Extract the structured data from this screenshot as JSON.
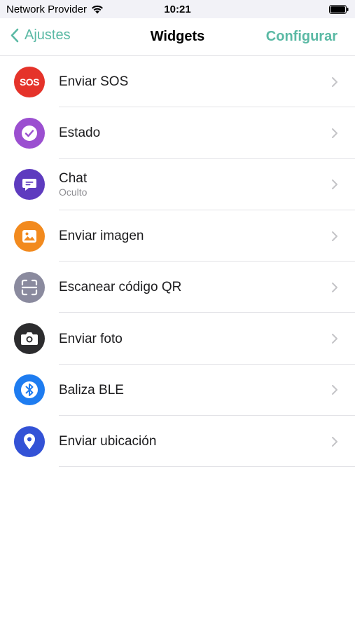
{
  "status_bar": {
    "carrier": "Network Provider",
    "time": "10:21"
  },
  "nav": {
    "back_label": "Ajustes",
    "title": "Widgets",
    "action_label": "Configurar",
    "accent_color": "#5ab9a4"
  },
  "widgets": [
    {
      "label": "Enviar SOS",
      "icon": "sos-icon",
      "icon_text": "SOS",
      "color": "#e5332a"
    },
    {
      "label": "Estado",
      "icon": "check-circle-icon",
      "color": "#9b4fd0"
    },
    {
      "label": "Chat",
      "sublabel": "Oculto",
      "icon": "chat-bubble-icon",
      "color": "#5e3bbf"
    },
    {
      "label": "Enviar imagen",
      "icon": "image-icon",
      "color": "#f28a1e"
    },
    {
      "label": "Escanear código QR",
      "icon": "qr-scan-icon",
      "color": "#8a8a9e"
    },
    {
      "label": "Enviar foto",
      "icon": "camera-icon",
      "color": "#2c2c2e"
    },
    {
      "label": "Baliza BLE",
      "icon": "bluetooth-icon",
      "color": "#1e7cf0"
    },
    {
      "label": "Enviar ubicación",
      "icon": "location-pin-icon",
      "color": "#3352d6"
    }
  ]
}
